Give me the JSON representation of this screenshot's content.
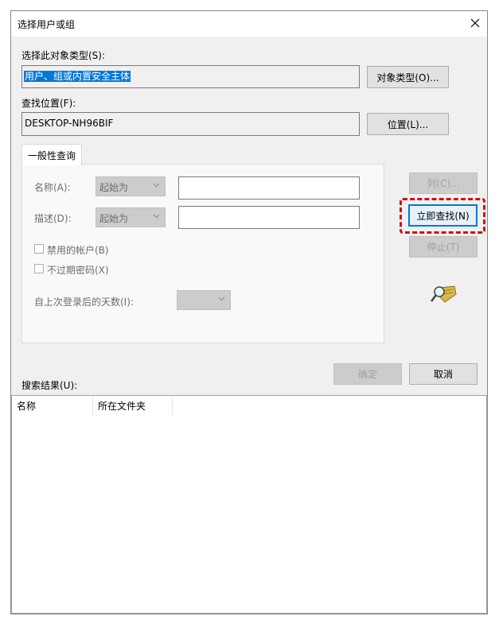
{
  "window": {
    "title": "选择用户或组"
  },
  "object_type": {
    "label": "选择此对象类型(S):",
    "value": "用户、组或内置安全主体",
    "button": "对象类型(O)..."
  },
  "location": {
    "label": "查找位置(F):",
    "value": "DESKTOP-NH96BIF",
    "button": "位置(L)..."
  },
  "query_tab": {
    "label": "一般性查询",
    "name_label": "名称(A):",
    "name_combo": "起始为",
    "desc_label": "描述(D):",
    "desc_combo": "起始为",
    "disabled_accounts": "禁用的帐户(B)",
    "non_expiring_pwd": "不过期密码(X)",
    "days_label": "自上次登录后的天数(I):"
  },
  "side_buttons": {
    "columns": "列(C)...",
    "find_now": "立即查找(N)",
    "stop": "停止(T)"
  },
  "footer": {
    "ok": "确定",
    "cancel": "取消",
    "results_label": "搜索结果(U):"
  },
  "results": {
    "columns": [
      "名称",
      "所在文件夹"
    ],
    "rows": []
  },
  "colors": {
    "highlight": "#0078d7",
    "annotation": "#d01010"
  }
}
